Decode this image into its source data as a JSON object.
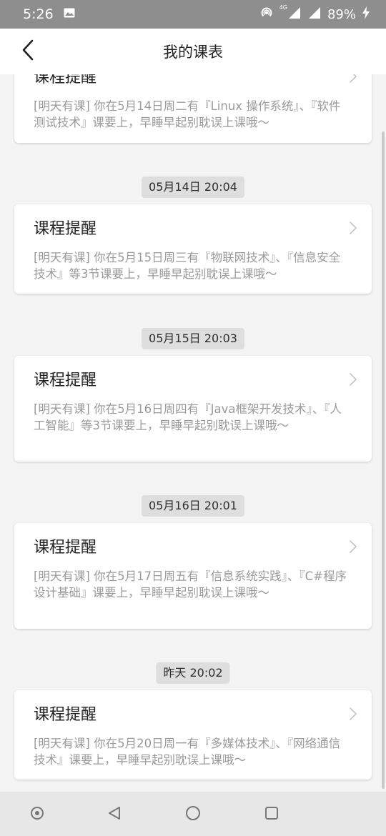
{
  "status": {
    "time": "5:26",
    "net_label": "4G",
    "battery_pct": "89%"
  },
  "header": {
    "title": "我的课表"
  },
  "feed": {
    "items": [
      {
        "stamp": "",
        "title": "课程提醒",
        "body": "[明天有课] 你在5月14日周二有『Linux 操作系统』、『软件测试技术』课要上，早睡早起别耽误上课哦～"
      },
      {
        "stamp": "05月14日 20:04",
        "title": "课程提醒",
        "body": "[明天有课] 你在5月15日周三有『物联网技术』、『信息安全技术』等3节课要上，早睡早起别耽误上课哦～"
      },
      {
        "stamp": "05月15日 20:03",
        "title": "课程提醒",
        "body": "[明天有课] 你在5月16日周四有『Java框架开发技术』、『人工智能』等3节课要上，早睡早起别耽误上课哦～"
      },
      {
        "stamp": "05月16日 20:01",
        "title": "课程提醒",
        "body": "[明天有课] 你在5月17日周五有『信息系统实践』、『C#程序设计基础』课要上，早睡早起别耽误上课哦～"
      },
      {
        "stamp": "昨天 20:02",
        "title": "课程提醒",
        "body": "[明天有课] 你在5月20日周一有『多媒体技术』、『网络通信技术』课要上，早睡早起别耽误上课哦～"
      }
    ]
  },
  "icons": {
    "back": "chevron-left-icon",
    "card_arrow": "chevron-right-icon",
    "nav": [
      "accessibility-dot-icon",
      "back-triangle-icon",
      "home-circle-icon",
      "recents-square-icon"
    ]
  },
  "colors": {
    "status_bar": "#8e8e8e",
    "background": "#f4f4f4",
    "card": "#ffffff",
    "stamp_bg": "#dedede",
    "body_text": "#9a9a9a"
  }
}
